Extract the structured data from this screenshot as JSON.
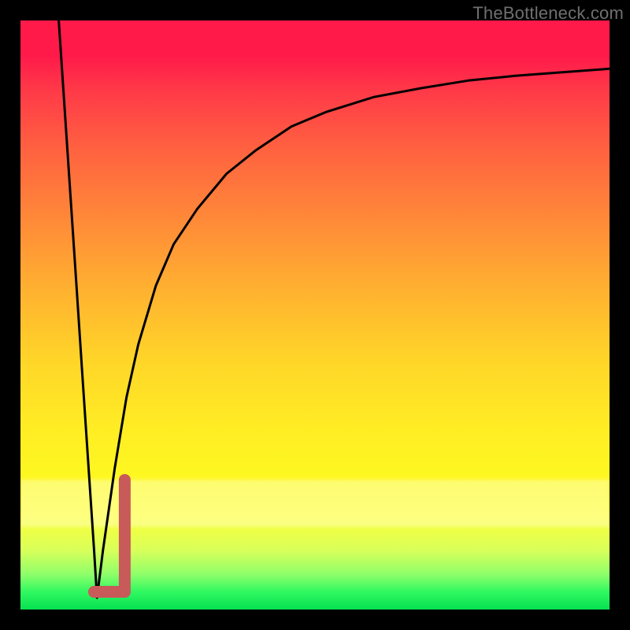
{
  "watermark": "TheBottleneck.com",
  "colors": {
    "frame": "#000000",
    "curve_stroke": "#000000",
    "marker_stroke": "#c85a5a",
    "gradient_top": "#ff1a4a",
    "gradient_bottom": "#06e052"
  },
  "chart_data": {
    "type": "line",
    "title": "",
    "xlabel": "",
    "ylabel": "",
    "xlim": [
      0,
      100
    ],
    "ylim": [
      0,
      100
    ],
    "grid": false,
    "series": [
      {
        "name": "left-branch",
        "x": [
          6.5,
          7.5,
          8.5,
          9.5,
          10.5,
          11.5,
          12.5,
          13.0
        ],
        "y": [
          100,
          85,
          70,
          55,
          40,
          25,
          10,
          2
        ]
      },
      {
        "name": "right-branch",
        "x": [
          13.0,
          14,
          16,
          18,
          20,
          23,
          26,
          30,
          35,
          40,
          46,
          52,
          60,
          68,
          76,
          84,
          92,
          100
        ],
        "y": [
          2,
          10,
          24,
          36,
          45,
          55,
          62,
          68,
          74,
          78,
          82,
          84.5,
          87,
          88.5,
          89.8,
          90.6,
          91.2,
          91.8
        ]
      }
    ],
    "marker": {
      "name": "J-marker",
      "vertical": {
        "x": 17.7,
        "y_from": 3,
        "y_to": 22
      },
      "horizontal": {
        "y": 3,
        "x_from": 12.5,
        "x_to": 17.7
      },
      "foot_dot": {
        "x": 12.5,
        "y": 3
      }
    }
  }
}
